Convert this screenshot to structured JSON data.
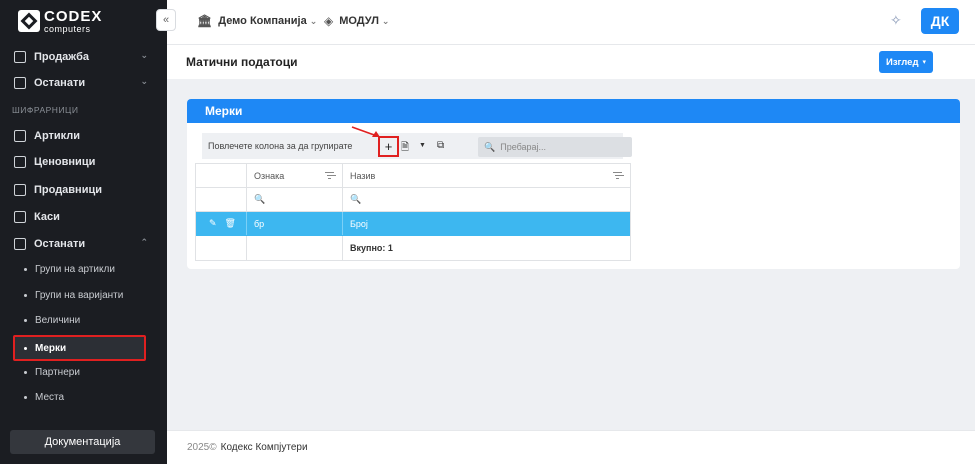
{
  "brand": {
    "title": "CODEX",
    "subtitle": "computers"
  },
  "sidebar": {
    "items": [
      {
        "label": "Продажба"
      },
      {
        "label": "Останати"
      }
    ],
    "section_label": "ШИФРАРНИЦИ",
    "section_items": [
      {
        "label": "Артикли"
      },
      {
        "label": "Ценовници"
      },
      {
        "label": "Продавници"
      },
      {
        "label": "Каси"
      },
      {
        "label": "Останати"
      }
    ],
    "sub_items": [
      {
        "label": "Групи на артикли"
      },
      {
        "label": "Групи на варијанти"
      },
      {
        "label": "Величини"
      },
      {
        "label": "Мерки"
      },
      {
        "label": "Партнери"
      },
      {
        "label": "Места"
      }
    ],
    "doc_button": "Документација"
  },
  "topbar": {
    "company": "Демо Компанија",
    "module": "МОДУЛ",
    "avatar": "ДК"
  },
  "page": {
    "title": "Матични податоци",
    "view_button": "Изглед"
  },
  "card": {
    "title": "Мерки",
    "group_hint": "Повлечете колона за да групирате",
    "add_symbol": "+",
    "search_placeholder": "Пребарај..."
  },
  "grid": {
    "columns": [
      "Ознака",
      "Назив"
    ],
    "rows": [
      {
        "code": "бр",
        "name": "Број"
      }
    ],
    "total": "Вкупно: 1"
  },
  "footer": {
    "year": "2025©",
    "company": "Кодекс Компјутери"
  },
  "colors": {
    "accent": "#1e88f5",
    "selected_row": "#3db7f0",
    "sidebar_bg": "#1b1d22",
    "highlight": "#e02020"
  }
}
